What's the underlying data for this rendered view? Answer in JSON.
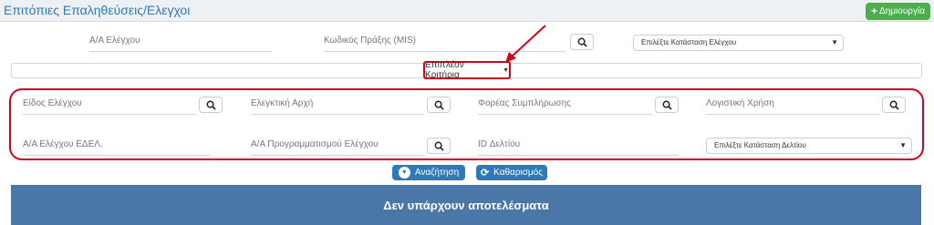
{
  "header": {
    "title": "Επιτόπιες Επαληθεύσεις/Ελεγχοι",
    "create_label": "Δημιουργία",
    "create_icon": "plus-icon"
  },
  "top_filters": {
    "control_number": "Α/Α Ελέγχου",
    "mis_code": "Κωδικός Πράξης (MIS)",
    "status_select": "Επιλέξτε Κατάσταση Ελέγχου"
  },
  "more_criteria": {
    "label": "Επιπλέον Κριτήρια"
  },
  "criteria": {
    "control_type": "Είδος Ελέγχου",
    "audit_authority": "Ελεγκτική Αρχή",
    "completion_body": "Φορέας Συμπλήρωσης",
    "fiscal_year": "Λογιστική Χρήση",
    "edel_number": "Α/Α Ελέγχου ΕΔΕΛ.",
    "planning_number": "Α/Α Προγραμματισμού Ελέγχου",
    "form_id": "ID Δελτίου",
    "form_status_select": "Επιλέξτε Κατάσταση Δελτίου"
  },
  "actions": {
    "search": "Αναζήτηση",
    "clear": "Καθαρισμός"
  },
  "results": {
    "empty_message": "Δεν υπάρχουν αποτελέσματα"
  },
  "colors": {
    "accent": "#2f79b9",
    "highlight": "#d0021b",
    "create": "#4cae4c",
    "results_bar": "#4a77a8"
  }
}
